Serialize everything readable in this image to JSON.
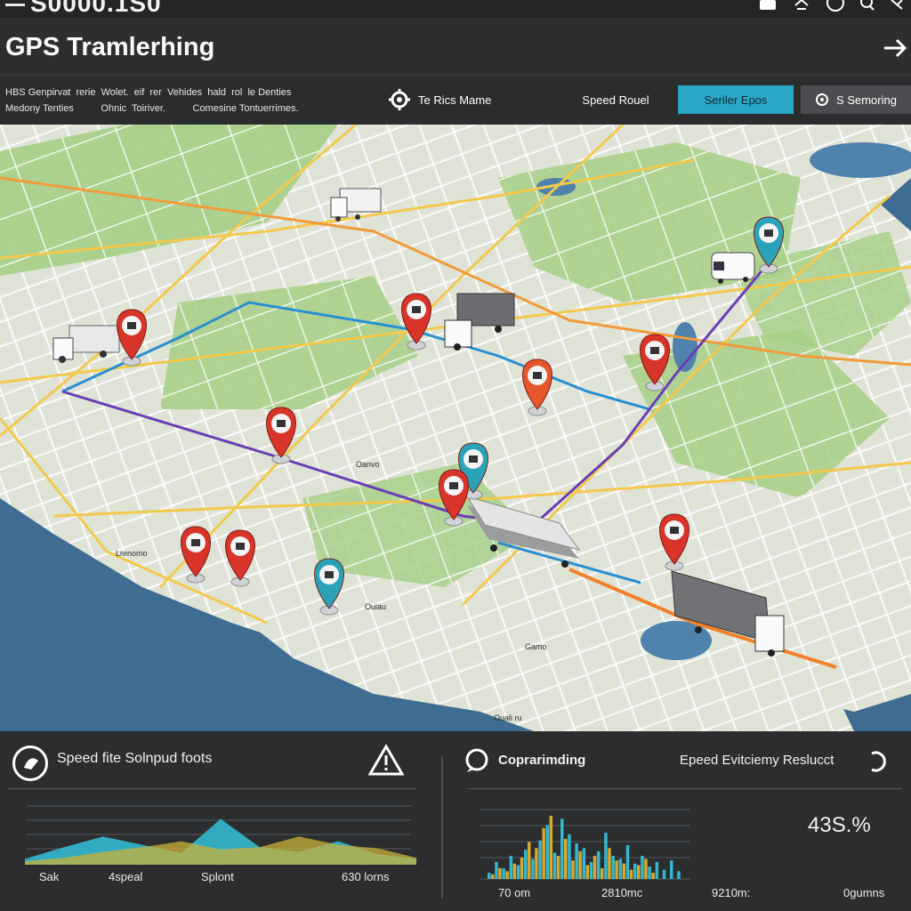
{
  "window": {
    "top_title": "S0000.1S0",
    "title": "GPS Tramlerhing"
  },
  "toolbar": {
    "info_line1": "HBS Genpirvat  rerie  Wolet.  eif  rer  Vehides  hald  rol  le Denties",
    "info_line2": "Medony Tenties          Ohnic  Toiriver.          Comesine Tontuerrimes.",
    "rules_label": "Te Rics Mame",
    "speed_label": "Speed Rouel",
    "earlier_label": "Seriler Epos",
    "scan_label": "S Semoring"
  },
  "icons": {
    "top": [
      "save-icon",
      "settings-icon",
      "compass-icon",
      "search-icon",
      "close-icon"
    ],
    "title_arrow": "arrow-right-icon"
  },
  "map": {
    "street_labels": [
      "Ouali ru",
      "Gamo",
      "Ouiau",
      "Oanvo",
      "Lrenomo"
    ],
    "pins": [
      {
        "color": "#d8342a",
        "icon": "eye"
      },
      {
        "color": "#d8342a",
        "icon": "car"
      },
      {
        "color": "#e5562a",
        "icon": "mail"
      },
      {
        "color": "#d8342a",
        "icon": "car"
      },
      {
        "color": "#d8342a",
        "icon": "mail"
      },
      {
        "color": "#2aa3b8",
        "icon": "eye"
      },
      {
        "color": "#d8342a",
        "icon": "doc"
      },
      {
        "color": "#d8342a",
        "icon": "bag"
      },
      {
        "color": "#d8342a",
        "icon": "person"
      },
      {
        "color": "#2aa3b8",
        "icon": "gear"
      },
      {
        "color": "#d8342a",
        "icon": "person"
      },
      {
        "color": "#2aa3b8",
        "icon": "mail"
      }
    ]
  },
  "left_panel": {
    "title": "Speed fite Solnpud foots",
    "x_labels": [
      "Sak",
      "4speal",
      "Splont",
      "630 lorns"
    ],
    "colors": {
      "teal": "#33b8cf",
      "yellow": "#c9b23a"
    }
  },
  "right_panel": {
    "title": "Coprarimding",
    "subtitle": "Epeed Evitciemy Reslucct",
    "value": "43S.%",
    "x_labels": [
      "70 om",
      "2810mc",
      "9210m:",
      "0gumns"
    ]
  },
  "chart_data": [
    {
      "type": "area",
      "title": "Speed fite Solnpud foots",
      "categories": [
        "Sak",
        "4speal",
        "Splont",
        "630 lorns"
      ],
      "series": [
        {
          "values": [
            10,
            30,
            48,
            34,
            20,
            78,
            30,
            22,
            40,
            18,
            10
          ]
        },
        {
          "values": [
            6,
            12,
            22,
            30,
            40,
            26,
            30,
            48,
            34,
            28,
            12
          ]
        }
      ]
    },
    {
      "type": "bar",
      "title": "Coprarimding",
      "categories": [
        "70 om",
        "2810mc",
        "9210m:",
        "0gumns"
      ],
      "series": [
        {
          "values": [
            8,
            22,
            14,
            30,
            18,
            38,
            26,
            50,
            70,
            34,
            78,
            58,
            46,
            40,
            22,
            36,
            60,
            30,
            26,
            44,
            20,
            30,
            16,
            22,
            12,
            24,
            10
          ]
        },
        {
          "values": [
            6,
            14,
            10,
            20,
            28,
            48,
            40,
            66,
            82,
            30,
            52,
            24,
            36,
            18,
            30,
            14,
            40,
            24,
            20,
            12,
            18,
            26,
            8
          ]
        }
      ]
    }
  ]
}
